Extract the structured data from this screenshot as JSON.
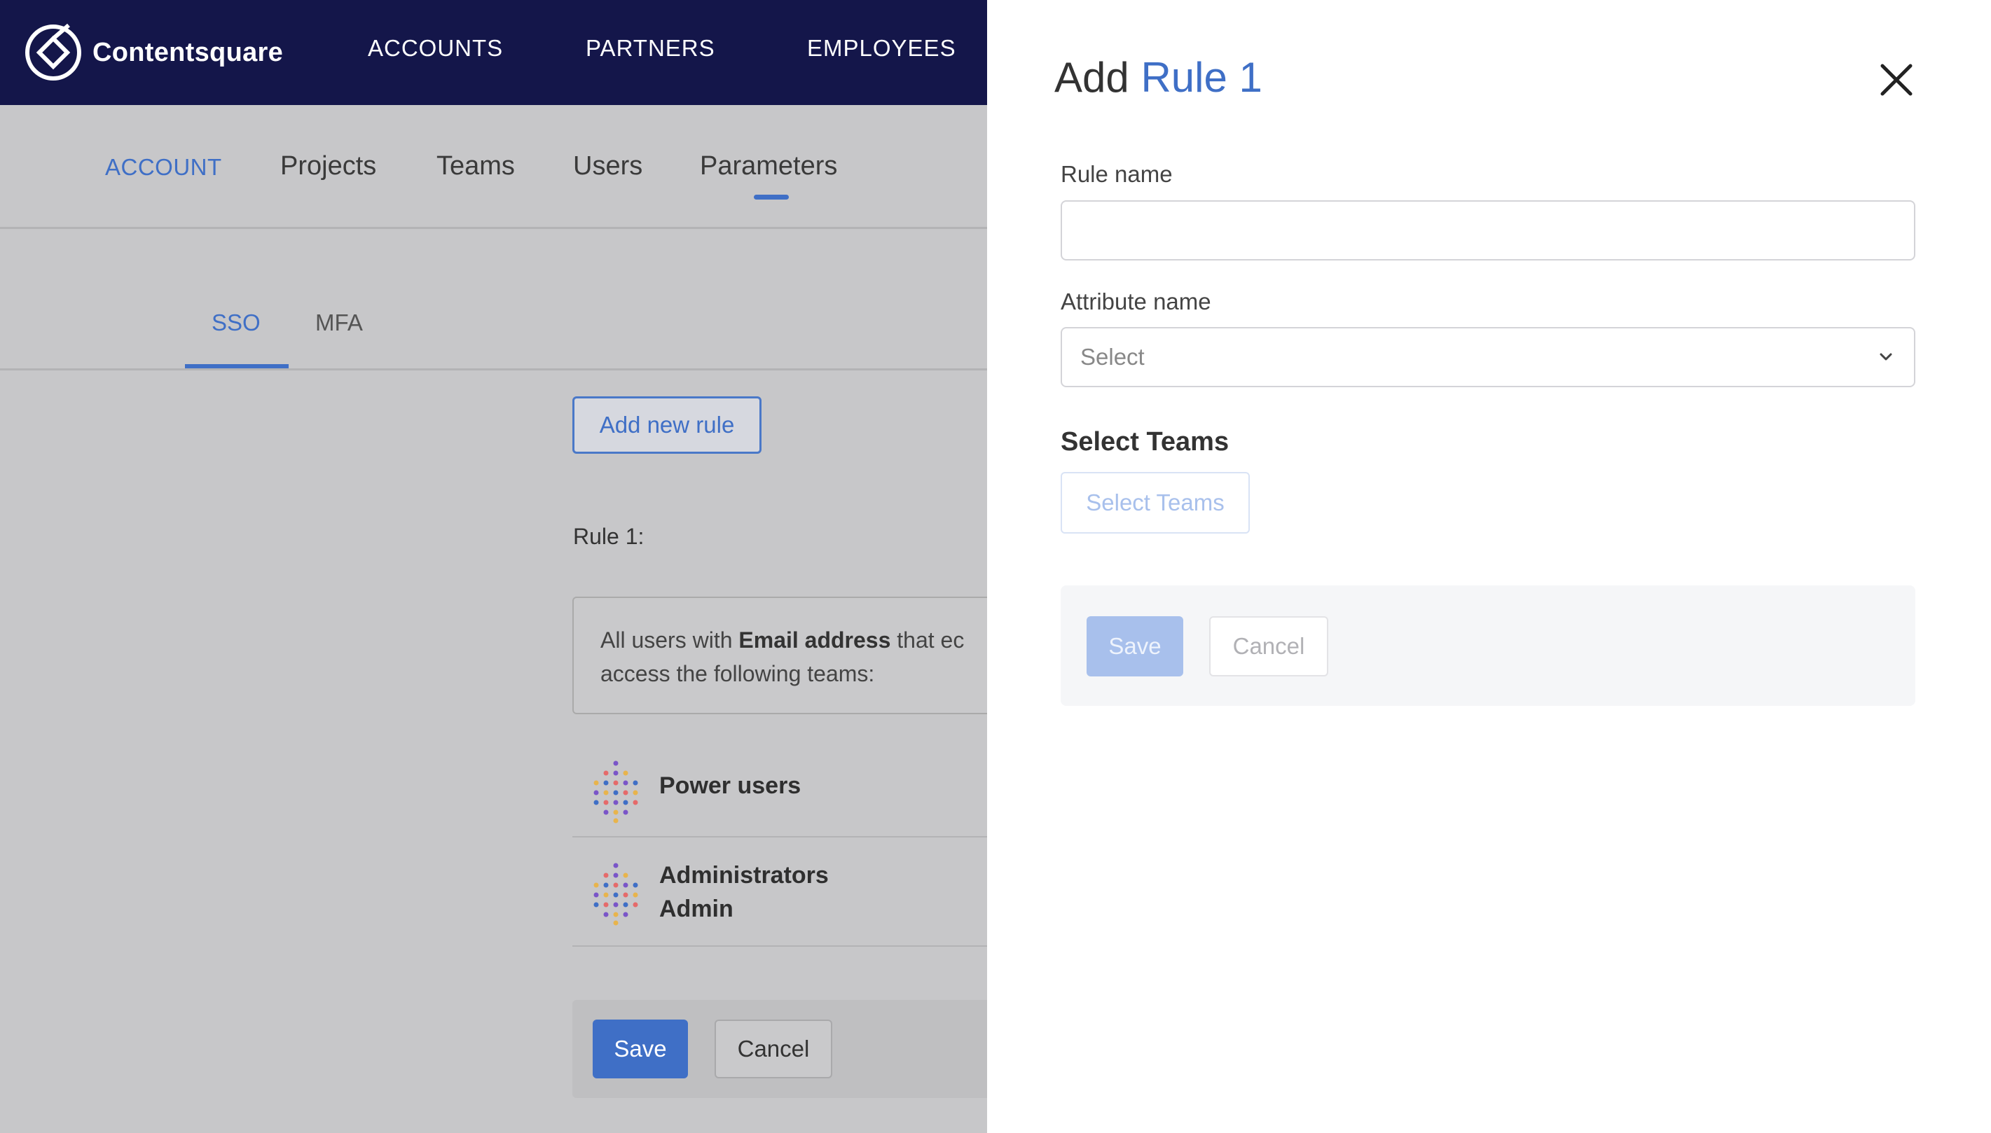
{
  "brand": {
    "name": "Contentsquare"
  },
  "topnav": {
    "items": [
      "ACCOUNTS",
      "PARTNERS",
      "EMPLOYEES"
    ]
  },
  "subnav": {
    "items": [
      "ACCOUNT",
      "Projects",
      "Teams",
      "Users",
      "Parameters"
    ],
    "active": "Parameters"
  },
  "auth_tabs": {
    "items": [
      "SSO",
      "MFA"
    ],
    "active": "SSO"
  },
  "page": {
    "add_rule_label": "Add new rule",
    "rule_label": "Rule 1:",
    "rule_desc_pre": "All users with ",
    "rule_desc_bold": "Email address",
    "rule_desc_post": " that ec",
    "rule_desc_line2": "access the following teams:",
    "teams": [
      {
        "name": "Power users"
      },
      {
        "name": "Administrators",
        "subname": "Admin"
      }
    ],
    "save_label": "Save",
    "cancel_label": "Cancel"
  },
  "drawer": {
    "title_prefix": "Add",
    "title_accent": "Rule 1",
    "rule_name_label": "Rule name",
    "rule_name_value": "",
    "attribute_label": "Attribute name",
    "attribute_placeholder": "Select",
    "select_teams_title": "Select Teams",
    "select_teams_button": "Select Teams",
    "save_label": "Save",
    "cancel_label": "Cancel"
  },
  "colors": {
    "nav_bg": "#14164a",
    "accent": "#3f6fc6",
    "overlay_bg": "#c7c7c9",
    "disabled_blue": "#a8c0ec"
  }
}
